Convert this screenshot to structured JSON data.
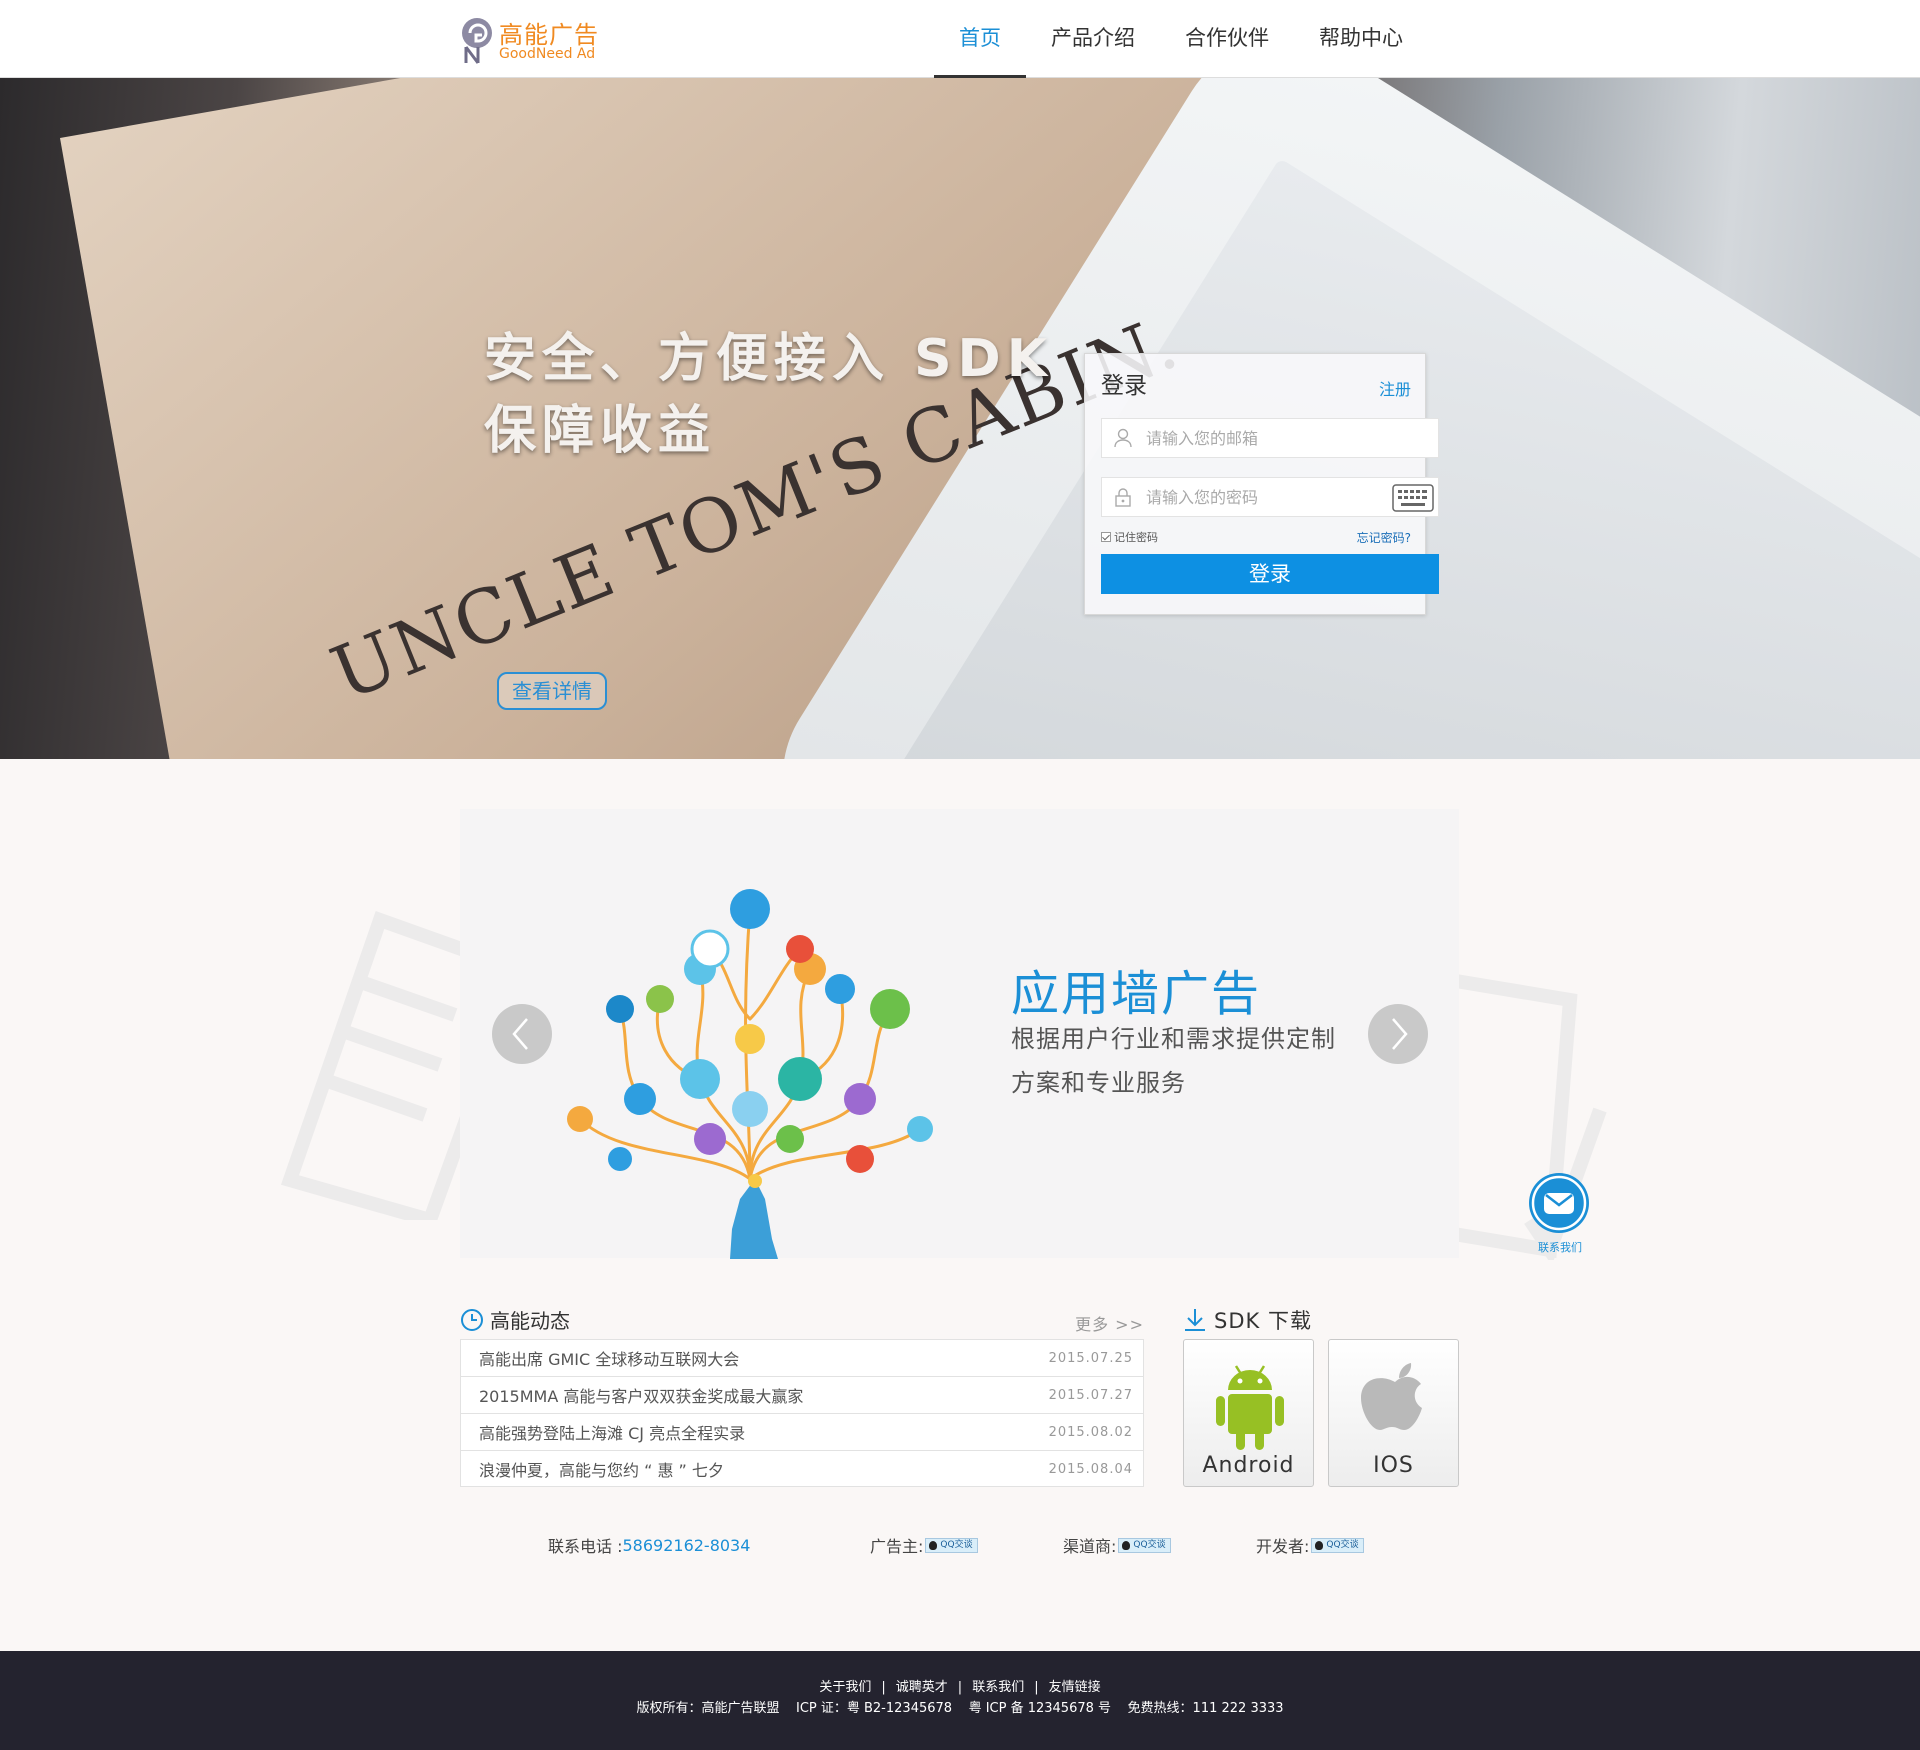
{
  "header": {
    "logo_cn": "高能广告",
    "logo_en": "GoodNeed Ad",
    "nav": [
      "首页",
      "产品介绍",
      "合作伙伴",
      "帮助中心"
    ],
    "active_nav": "首页"
  },
  "hero": {
    "book_text": "UNCLE TOM'S CABIN.",
    "slogan_line1": "安全、方便接入 SDK",
    "slogan_line2": "保障收益",
    "detail_button": "查看详情"
  },
  "login": {
    "title": "登录",
    "register_link": "注册",
    "email_placeholder": "请输入您的邮箱",
    "password_placeholder": "请输入您的密码",
    "remember_label": "记住密码",
    "forgot_link": "忘记密码?",
    "submit_label": "登录"
  },
  "banner": {
    "title": "应用墙广告",
    "description": "根据用户行业和需求提供定制方案和专业服务"
  },
  "contact_float": {
    "label": "联系我们"
  },
  "news": {
    "title": "高能动态",
    "more": "更多 >>",
    "items": [
      {
        "text": "高能出席 GMIC 全球移动互联网大会",
        "date": "2015.07.25"
      },
      {
        "text": "2015MMA 高能与客户双双获金奖成最大赢家",
        "date": "2015.07.27"
      },
      {
        "text": "高能强势登陆上海滩 CJ 亮点全程实录",
        "date": "2015.08.02"
      },
      {
        "text": "浪漫仲夏，高能与您约 “ 惠 ” 七夕",
        "date": "2015.08.04"
      }
    ]
  },
  "sdk": {
    "title": "SDK 下载",
    "android_label": "Android",
    "ios_label": "IOS"
  },
  "contacts": {
    "phone_label": "联系电话 :",
    "phone": "58692162-8034",
    "advertiser_label": "广告主:",
    "channel_label": "渠道商:",
    "developer_label": "开发者:",
    "qq_badge": "QQ交谈"
  },
  "footer": {
    "links": [
      "关于我们",
      "诚聘英才",
      "联系我们",
      "友情链接"
    ],
    "separator": "|",
    "copyright": "版权所有：高能广告联盟    ICP 证：粤 B2-12345678    粤 ICP 备 12345678 号    免费热线：111 222 3333"
  },
  "colors": {
    "accent": "#1b8fd6",
    "logo": "#f08a21",
    "footer_bg": "#24232f",
    "button": "#0d90e3"
  }
}
